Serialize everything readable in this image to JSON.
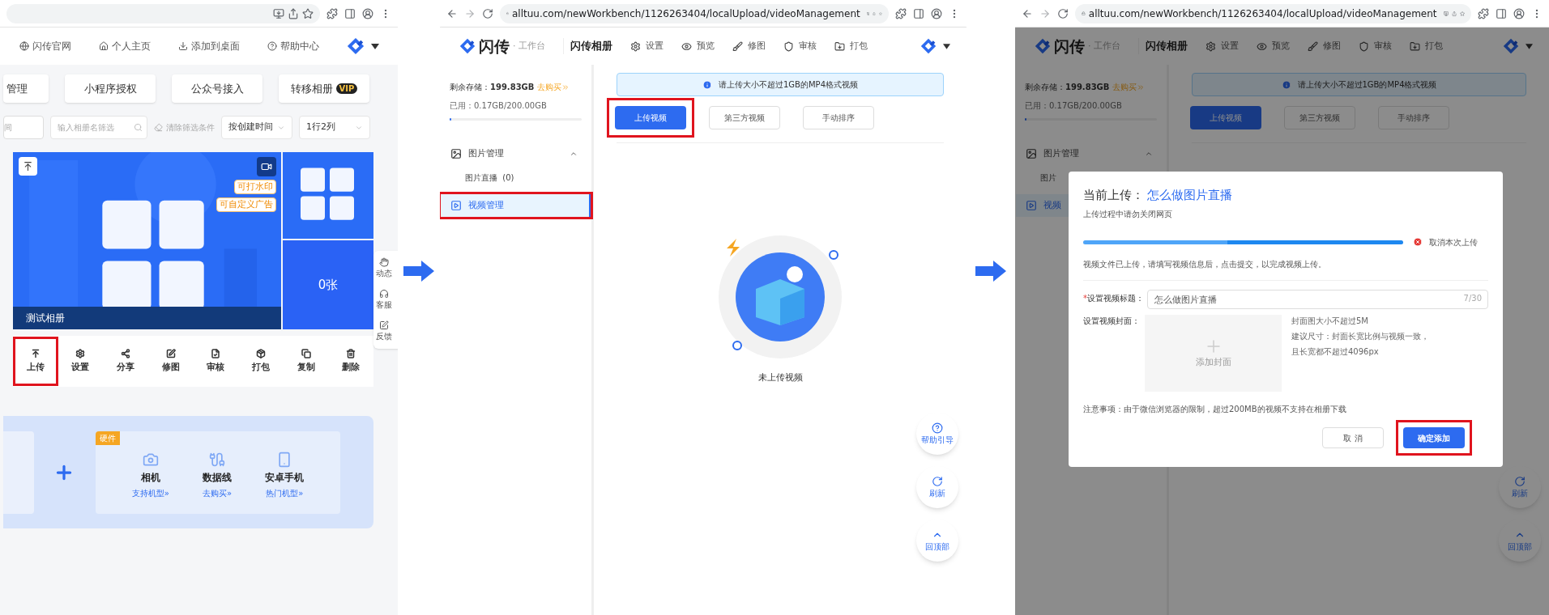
{
  "step_1": {
    "top_nav": [
      {
        "label": "闪传官网"
      },
      {
        "label": "个人主页"
      },
      {
        "label": "添加到桌面"
      },
      {
        "label": "帮助中心"
      }
    ],
    "tabs": [
      {
        "label": "管理"
      },
      {
        "label": "小程序授权"
      },
      {
        "label": "公众号接入"
      },
      {
        "label": "转移相册",
        "badge": "VIP"
      }
    ],
    "filters": {
      "date_field": "间",
      "search_placeholder": "输入相册名筛选",
      "clear": "清除筛选条件",
      "sort": "按创建时间",
      "layout": "1行2列"
    },
    "album": {
      "name": "测试相册",
      "tags": [
        "可打水印",
        "可自定义广告"
      ],
      "photo_count": "0张"
    },
    "actions": [
      {
        "label": "上传",
        "highlighted": true
      },
      {
        "label": "设置",
        "highlighted": false
      },
      {
        "label": "分享",
        "highlighted": false
      },
      {
        "label": "修图",
        "highlighted": false
      },
      {
        "label": "审核",
        "highlighted": false
      },
      {
        "label": "打包",
        "highlighted": false
      },
      {
        "label": "复制",
        "highlighted": false
      },
      {
        "label": "删除",
        "highlighted": false
      }
    ],
    "side_tools": [
      "动态",
      "客服",
      "反馈"
    ],
    "hardware": {
      "badge": "硬件",
      "items": [
        {
          "name": "相机",
          "link": "支持机型»"
        },
        {
          "name": "数据线",
          "link": "去购买»"
        },
        {
          "name": "安卓手机",
          "link": "热门机型»"
        }
      ]
    }
  },
  "step_2": {
    "browser": {
      "url": "alltuu.com/newWorkbench/1126263404/localUpload/videoManagement"
    },
    "header": {
      "brand": "闪传",
      "subtitle": "· 工作台",
      "title": "闪传相册",
      "nav": [
        "设置",
        "预览",
        "修图",
        "审核",
        "打包"
      ]
    },
    "storage": {
      "label": "剩余存储：",
      "value": "199.83GB",
      "buy": "去购买",
      "used": "已用：0.17GB/200.00GB",
      "level": 0.01
    },
    "menu": [
      {
        "label": "图片管理",
        "expanded": true,
        "selected": false,
        "highlighted": false,
        "children": [
          {
            "label": "图片直播",
            "count": "(0)",
            "selected": false
          }
        ]
      },
      {
        "label": "视频管理",
        "selected": true,
        "highlighted": true
      }
    ],
    "notice": "请上传大小不超过1GB的MP4格式视频",
    "buttons": [
      {
        "label": "上传视频",
        "kind": "primary",
        "highlighted": true
      },
      {
        "label": "第三方视频",
        "kind": "default",
        "highlighted": false
      },
      {
        "label": "手动排序",
        "kind": "default",
        "highlighted": false
      }
    ],
    "empty_text": "未上传视频",
    "float_tools": [
      {
        "label": "帮助引导",
        "kind": "help"
      },
      {
        "label": "刷新",
        "kind": "refresh"
      },
      {
        "label": "回顶部",
        "kind": "top"
      }
    ]
  },
  "step_3": {
    "browser": {
      "url": "alltuu.com/newWorkbench/1126263404/localUpload/videoManagement"
    },
    "header": {
      "brand": "闪传",
      "subtitle": "· 工作台",
      "title": "闪传相册",
      "nav": [
        "设置",
        "预览",
        "修图",
        "审核",
        "打包"
      ]
    },
    "storage": {
      "label": "剩余存储：",
      "value": "199.83GB",
      "buy": "去购买",
      "used": "已用：0.17GB/200.00GB",
      "level": 0.01
    },
    "menu": [
      {
        "label": "图片管理",
        "expanded": true,
        "selected": false,
        "highlighted": false,
        "children": [
          {
            "label": "图片",
            "selected": false
          }
        ]
      },
      {
        "label": "视频",
        "selected": true,
        "highlighted": false
      }
    ],
    "notice": "请上传大小不超过1GB的MP4格式视频",
    "buttons": [
      {
        "label": "上传视频",
        "kind": "primary",
        "highlighted": false
      },
      {
        "label": "第三方视频",
        "kind": "default",
        "highlighted": false
      },
      {
        "label": "手动排序",
        "kind": "default",
        "highlighted": false
      }
    ],
    "float_tools": [
      {
        "label": "刷新",
        "kind": "refresh"
      },
      {
        "label": "回顶部",
        "kind": "top"
      }
    ],
    "dialog": {
      "title": "当前上传：",
      "file_name": "怎么做图片直播",
      "warning": "上传过程中请勿关闭网页",
      "level": 1,
      "cancel_upload": "取消本次上传",
      "info": "视频文件已上传，请填写视频信息后，点击提交，以完成视频上传。",
      "title_field": {
        "required_mark": "*",
        "label": "设置视频标题：",
        "value": "怎么做图片直播",
        "count": "7/30"
      },
      "cover": {
        "label": "设置视频封面：",
        "add": "添加封面",
        "hints": [
          "封面图大小不超过5M",
          "建议尺寸：封面长宽比例与视频一致，",
          "且长宽都不超过4096px"
        ]
      },
      "note": "注意事项：由于微信浏览器的限制，超过200MB的视频不支持在相册下载",
      "buttons": [
        {
          "label": "取 消",
          "kind": "default",
          "highlighted": false
        },
        {
          "label": "确定添加",
          "kind": "primary",
          "highlighted": true
        }
      ]
    }
  }
}
